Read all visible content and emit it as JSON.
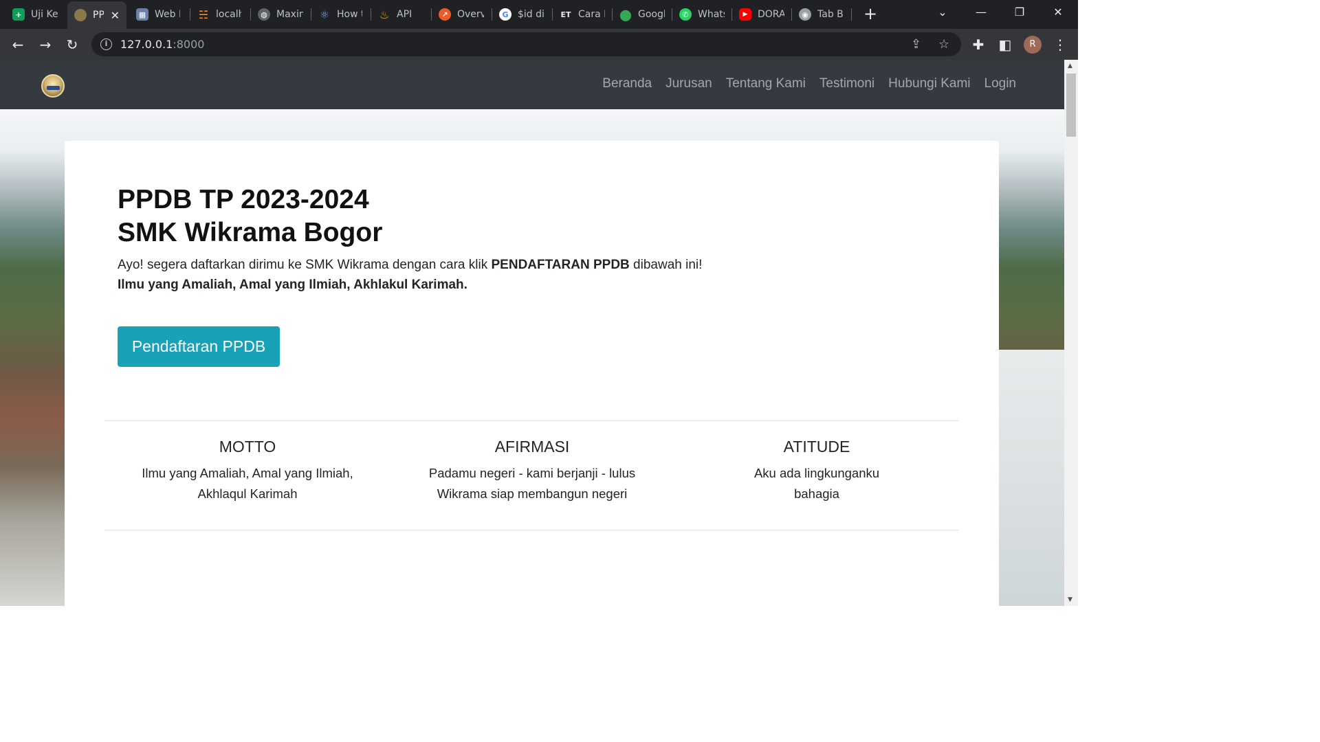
{
  "browser": {
    "tabs": [
      {
        "title": "Uji Ke",
        "icon": "sheets-icon",
        "color": "#0f9d58"
      },
      {
        "title": "PP",
        "icon": "school-logo-icon",
        "color": "#8a7a4a",
        "active": true
      },
      {
        "title": "Web F",
        "icon": "building-icon",
        "color": "#6b7fa8"
      },
      {
        "title": "localh",
        "icon": "xampp-icon",
        "color": "#f28c28"
      },
      {
        "title": "Maxin",
        "icon": "globe-icon",
        "color": "#5f6368"
      },
      {
        "title": "How t",
        "icon": "react-icon",
        "color": "#4a6fd6"
      },
      {
        "title": "API",
        "icon": "fire-icon",
        "color": "#f4a025"
      },
      {
        "title": "Overv",
        "icon": "postman-icon",
        "color": "#ef5b25"
      },
      {
        "title": "$id di",
        "icon": "google-icon",
        "color": "#ffffff"
      },
      {
        "title": "Cara I",
        "icon": "et-icon",
        "color": "#202124"
      },
      {
        "title": "Googl",
        "icon": "maps-pin-icon",
        "color": "#34a853"
      },
      {
        "title": "Whats",
        "icon": "whatsapp-icon",
        "color": "#25d366"
      },
      {
        "title": "DORA",
        "icon": "youtube-icon",
        "color": "#ff0000"
      },
      {
        "title": "Tab B",
        "icon": "chrome-icon",
        "color": "#9aa0a6"
      }
    ],
    "url_host": "127.0.0.1",
    "url_port": ":8000",
    "profile_initial": "R"
  },
  "site": {
    "nav": [
      "Beranda",
      "Jurusan",
      "Tentang Kami",
      "Testimoni",
      "Hubungi Kami",
      "Login"
    ]
  },
  "hero": {
    "title_line1": "PPDB TP 2023-2024",
    "title_line2": "SMK Wikrama Bogor",
    "lead_pre": "Ayo! segera daftarkan dirimu ke SMK Wikrama dengan cara klik ",
    "lead_bold": "PENDAFTARAN PPDB",
    "lead_post": " dibawah ini!",
    "tagline": "Ilmu yang Amaliah, Amal yang Ilmiah, Akhlakul Karimah.",
    "button_label": "Pendaftaran PPDB",
    "button_color": "#17a2b8"
  },
  "values": [
    {
      "title": "MOTTO",
      "text": "Ilmu yang Amaliah, Amal yang Ilmiah, Akhlaqul Karimah"
    },
    {
      "title": "AFIRMASI",
      "text": "Padamu negeri - kami berjanji - lulus Wikrama siap membangun negeri"
    },
    {
      "title": "ATITUDE",
      "text": "Aku ada lingkunganku bahagia"
    }
  ]
}
